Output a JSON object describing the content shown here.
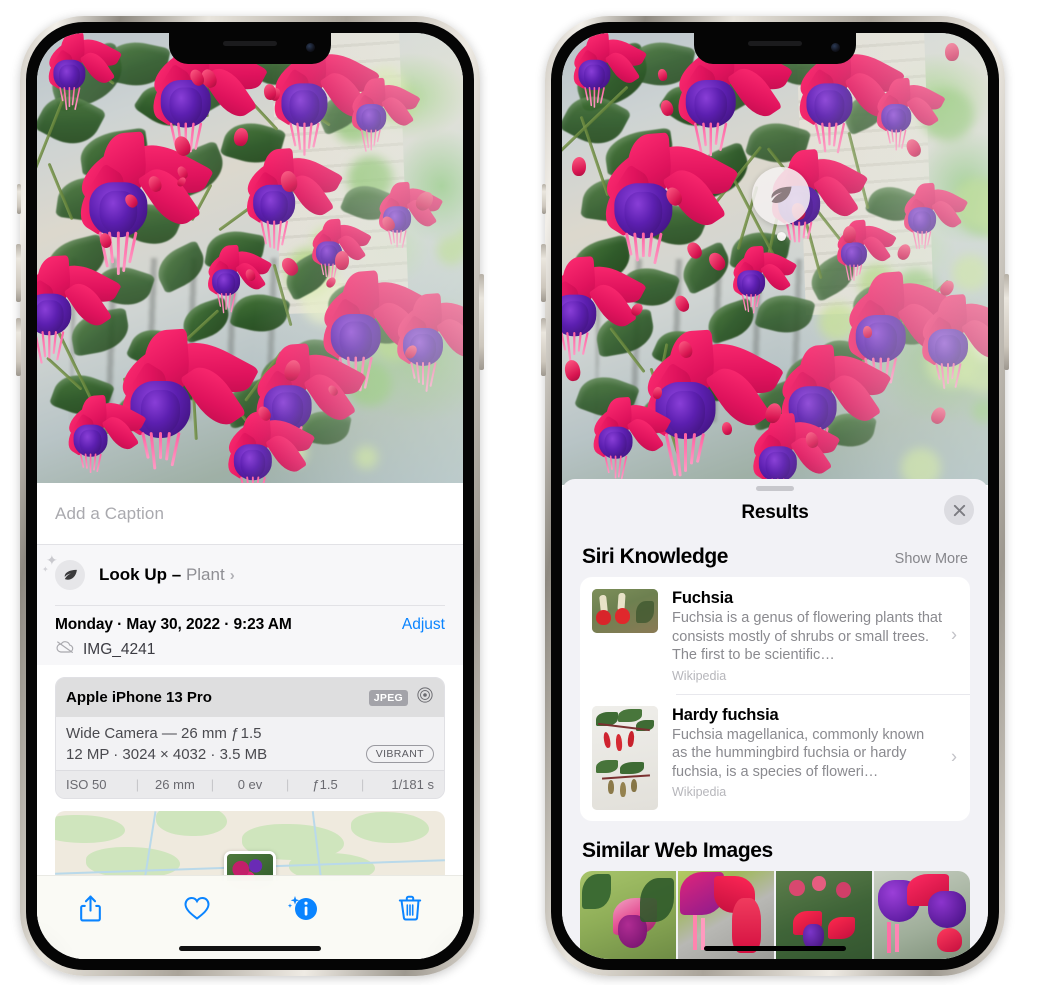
{
  "left_phone": {
    "name": "iPhone photo detail view",
    "caption_field": {
      "placeholder": "Add a Caption",
      "value": ""
    },
    "look_up": {
      "icon": "leaf-icon",
      "sparkle_icon": "sparkle-icon",
      "label": "Look Up",
      "dash": "–",
      "subject": "Plant",
      "chevron": "›"
    },
    "metadata": {
      "date_line": "Monday · May 30, 2022 · 9:23 AM",
      "adjust_label": "Adjust",
      "cloud_icon": "icloud-slash-icon",
      "filename": "IMG_4241"
    },
    "camera_card": {
      "device": "Apple iPhone 13 Pro",
      "format_badge": "JPEG",
      "aperture_icon": "aperture-icon",
      "lens_line": "Wide Camera — 26 mm ƒ 1.5",
      "size_line": "12 MP · 3024 × 4032 · 3.5 MB",
      "style_badge": "VIBRANT",
      "exif": [
        "ISO 50",
        "26 mm",
        "0 ev",
        "ƒ1.5",
        "1/181 s"
      ]
    },
    "toolbar": [
      {
        "name": "share-button",
        "icon": "share-icon"
      },
      {
        "name": "favorite-button",
        "icon": "heart-icon"
      },
      {
        "name": "info-button",
        "icon": "info-sparkle-icon"
      },
      {
        "name": "delete-button",
        "icon": "trash-icon"
      }
    ],
    "accent_color": "#0a84ff"
  },
  "right_phone": {
    "name": "Visual Look Up results",
    "photo_badge": {
      "icon": "leaf-icon",
      "label": "visual-look-up-badge"
    },
    "sheet": {
      "grabber": "drag-handle",
      "title": "Results",
      "close_icon": "close-icon"
    },
    "siri_knowledge": {
      "section_title": "Siri Knowledge",
      "action": "Show More",
      "items": [
        {
          "title": "Fuchsia",
          "description": "Fuchsia is a genus of flowering plants that consists mostly of shrubs or small trees. The first to be scientific…",
          "source": "Wikipedia",
          "chevron": "›"
        },
        {
          "title": "Hardy fuchsia",
          "description": "Fuchsia magellanica, commonly known as the hummingbird fuchsia or hardy fuchsia, is a species of floweri…",
          "source": "Wikipedia",
          "chevron": "›"
        }
      ]
    },
    "similar_web_images": {
      "section_title": "Similar Web Images",
      "thumbnails": [
        "web-image-1",
        "web-image-2",
        "web-image-3",
        "web-image-4"
      ]
    }
  },
  "colors": {
    "accent_blue": "#0a84ff",
    "sheet_bg": "#f2f2f6",
    "card_bg": "#ffffff",
    "secondary_text": "#8a8a8f"
  }
}
